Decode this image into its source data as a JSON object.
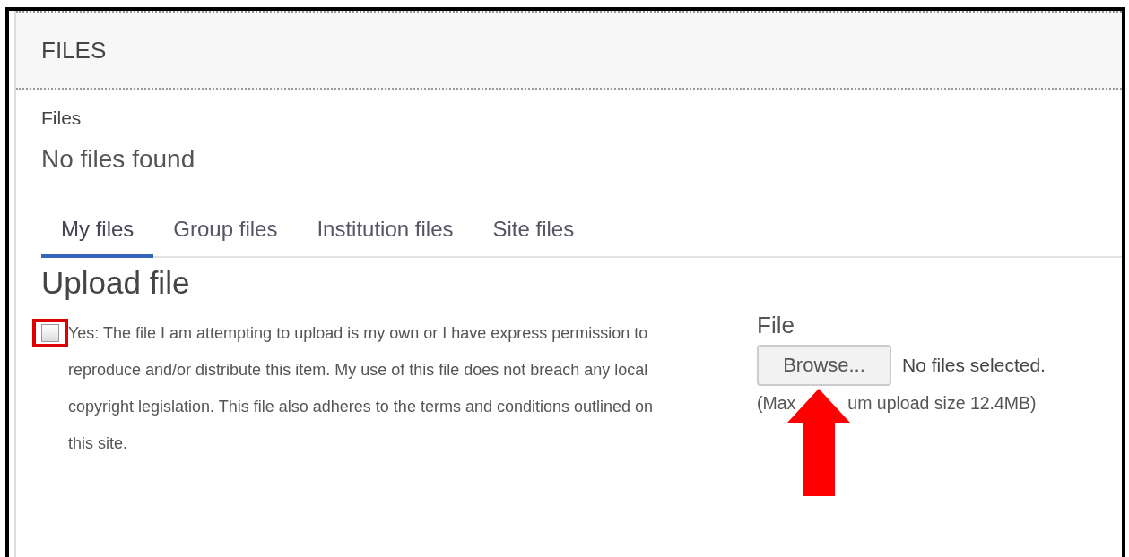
{
  "header": {
    "title": "FILES"
  },
  "section_label": "Files",
  "empty_message": "No files found",
  "tabs": [
    {
      "label": "My files",
      "selected": true
    },
    {
      "label": "Group files",
      "selected": false
    },
    {
      "label": "Institution files",
      "selected": false
    },
    {
      "label": "Site files",
      "selected": false
    }
  ],
  "upload": {
    "title": "Upload file",
    "consent": {
      "checked": false,
      "text": "Yes: The file I am attempting to upload is my own or I have express permission to reproduce and/or distribute this item. My use of this file does not breach any local copyright legislation. This file also adheres to the terms and conditions outlined on this site."
    },
    "file": {
      "label": "File",
      "button": "Browse...",
      "status": "No files selected.",
      "limit_visible_start": "(Max",
      "limit_visible_end": "um upload size 12.4MB)"
    }
  }
}
